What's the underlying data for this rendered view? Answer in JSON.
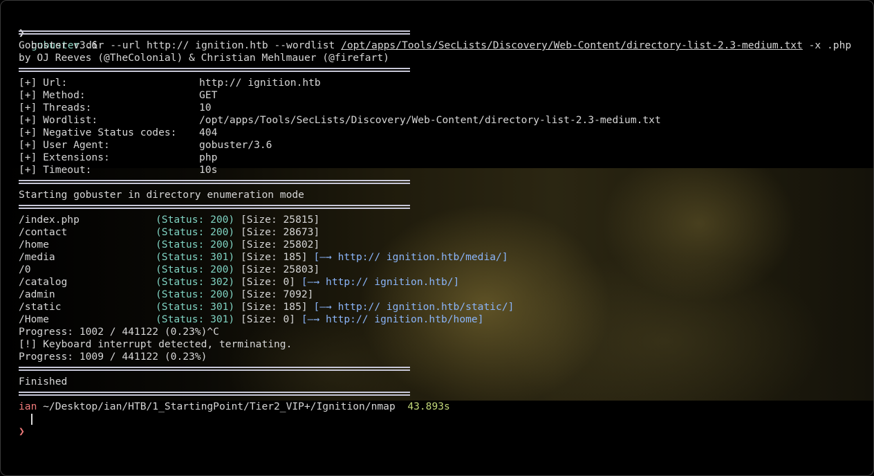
{
  "command": {
    "prompt_symbol": "❯",
    "program": "gobuster",
    "args_before_wordlist": " dir --url http:// ignition.htb --wordlist ",
    "wordlist_path": "/opt/apps/Tools/SecLists/Discovery/Web-Content/directory-list-2.3-medium.txt",
    "args_after_wordlist": " -x .php"
  },
  "banner": {
    "version": "Gobuster v3.6",
    "authors": "by OJ Reeves (@TheColonial) & Christian Mehlmauer (@firefart)"
  },
  "config": [
    {
      "label": "[+] Url:",
      "value": "http:// ignition.htb"
    },
    {
      "label": "[+] Method:",
      "value": "GET"
    },
    {
      "label": "[+] Threads:",
      "value": "10"
    },
    {
      "label": "[+] Wordlist:",
      "value": "/opt/apps/Tools/SecLists/Discovery/Web-Content/directory-list-2.3-medium.txt"
    },
    {
      "label": "[+] Negative Status codes:",
      "value": "404"
    },
    {
      "label": "[+] User Agent:",
      "value": "gobuster/3.6"
    },
    {
      "label": "[+] Extensions:",
      "value": "php"
    },
    {
      "label": "[+] Timeout:",
      "value": "10s"
    }
  ],
  "start_message": "Starting gobuster in directory enumeration mode",
  "results": [
    {
      "path": "/index.php",
      "status": "(Status: 200)",
      "size": " [Size: 25815]",
      "redirect": ""
    },
    {
      "path": "/contact",
      "status": "(Status: 200)",
      "size": " [Size: 28673]",
      "redirect": ""
    },
    {
      "path": "/home",
      "status": "(Status: 200)",
      "size": " [Size: 25802]",
      "redirect": ""
    },
    {
      "path": "/media",
      "status": "(Status: 301)",
      "size": " [Size: 185]",
      "redirect": " [—→ http:// ignition.htb/media/]"
    },
    {
      "path": "/0",
      "status": "(Status: 200)",
      "size": " [Size: 25803]",
      "redirect": ""
    },
    {
      "path": "/catalog",
      "status": "(Status: 302)",
      "size": " [Size: 0]",
      "redirect": " [—→ http:// ignition.htb/]"
    },
    {
      "path": "/admin",
      "status": "(Status: 200)",
      "size": " [Size: 7092]",
      "redirect": ""
    },
    {
      "path": "/static",
      "status": "(Status: 301)",
      "size": " [Size: 185]",
      "redirect": " [—→ http:// ignition.htb/static/]"
    },
    {
      "path": "/Home",
      "status": "(Status: 301)",
      "size": " [Size: 0]",
      "redirect": " [—→ http:// ignition.htb/home]"
    }
  ],
  "progress_1": "Progress: 1002 / 441122 (0.23%)^C",
  "interrupt": "[!] Keyboard interrupt detected, terminating.",
  "progress_2": "Progress: 1009 / 441122 (0.23%)",
  "finished": "Finished",
  "prompt": {
    "user": "ian",
    "cwd": " ~/Desktop/ian/HTB/1_StartingPoint/Tier2_VIP+/Ignition/nmap",
    "duration": "43.893s",
    "symbol": "❯"
  },
  "colors": {
    "command": "#8fd8c6",
    "status": "#7fd3c2",
    "link": "#8ab4f8",
    "user": "#f07a7a",
    "duration": "#c3d87a"
  }
}
